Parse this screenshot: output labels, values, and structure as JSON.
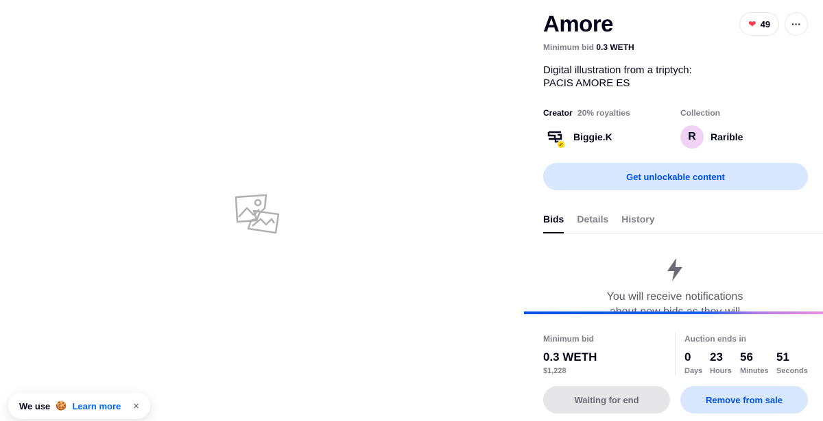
{
  "item": {
    "title": "Amore",
    "min_bid_label": "Minimum bid",
    "min_bid_value": "0.3 WETH",
    "likes": "49",
    "more_label": "···",
    "description_line1": "Digital illustration from a triptych:",
    "description_line2": "PACIS AMORE ES"
  },
  "creator": {
    "label": "Creator",
    "royalties": "20% royalties",
    "name": "Biggie.K",
    "verified_icon": "check"
  },
  "collection": {
    "label": "Collection",
    "name": "Rarible",
    "avatar_letter": "R"
  },
  "unlock_button": "Get unlockable content",
  "tabs": [
    {
      "label": "Bids",
      "active": true
    },
    {
      "label": "Details",
      "active": false
    },
    {
      "label": "History",
      "active": false
    }
  ],
  "bids_empty": {
    "icon": "lightning-bolt-icon",
    "message": "You will receive notifications about new bids as they will"
  },
  "bid_box": {
    "min_bid_label": "Minimum bid",
    "min_bid_value": "0.3 WETH",
    "min_bid_usd": "$1,228",
    "auction_label": "Auction ends in",
    "timer": [
      {
        "value": "0",
        "unit": "Days"
      },
      {
        "value": "23",
        "unit": "Hours"
      },
      {
        "value": "56",
        "unit": "Minutes"
      },
      {
        "value": "51",
        "unit": "Seconds"
      }
    ],
    "waiting_button": "Waiting for end",
    "remove_button": "Remove from sale"
  },
  "cookie": {
    "text": "We use",
    "emoji": "🍪",
    "link": "Learn more",
    "close": "×"
  },
  "colors": {
    "accent": "#0050e6",
    "heart": "#ff3b4b",
    "verified": "#ffd600",
    "collection_avatar": "#f0d2f5",
    "button_bg": "#d7e7ff"
  }
}
